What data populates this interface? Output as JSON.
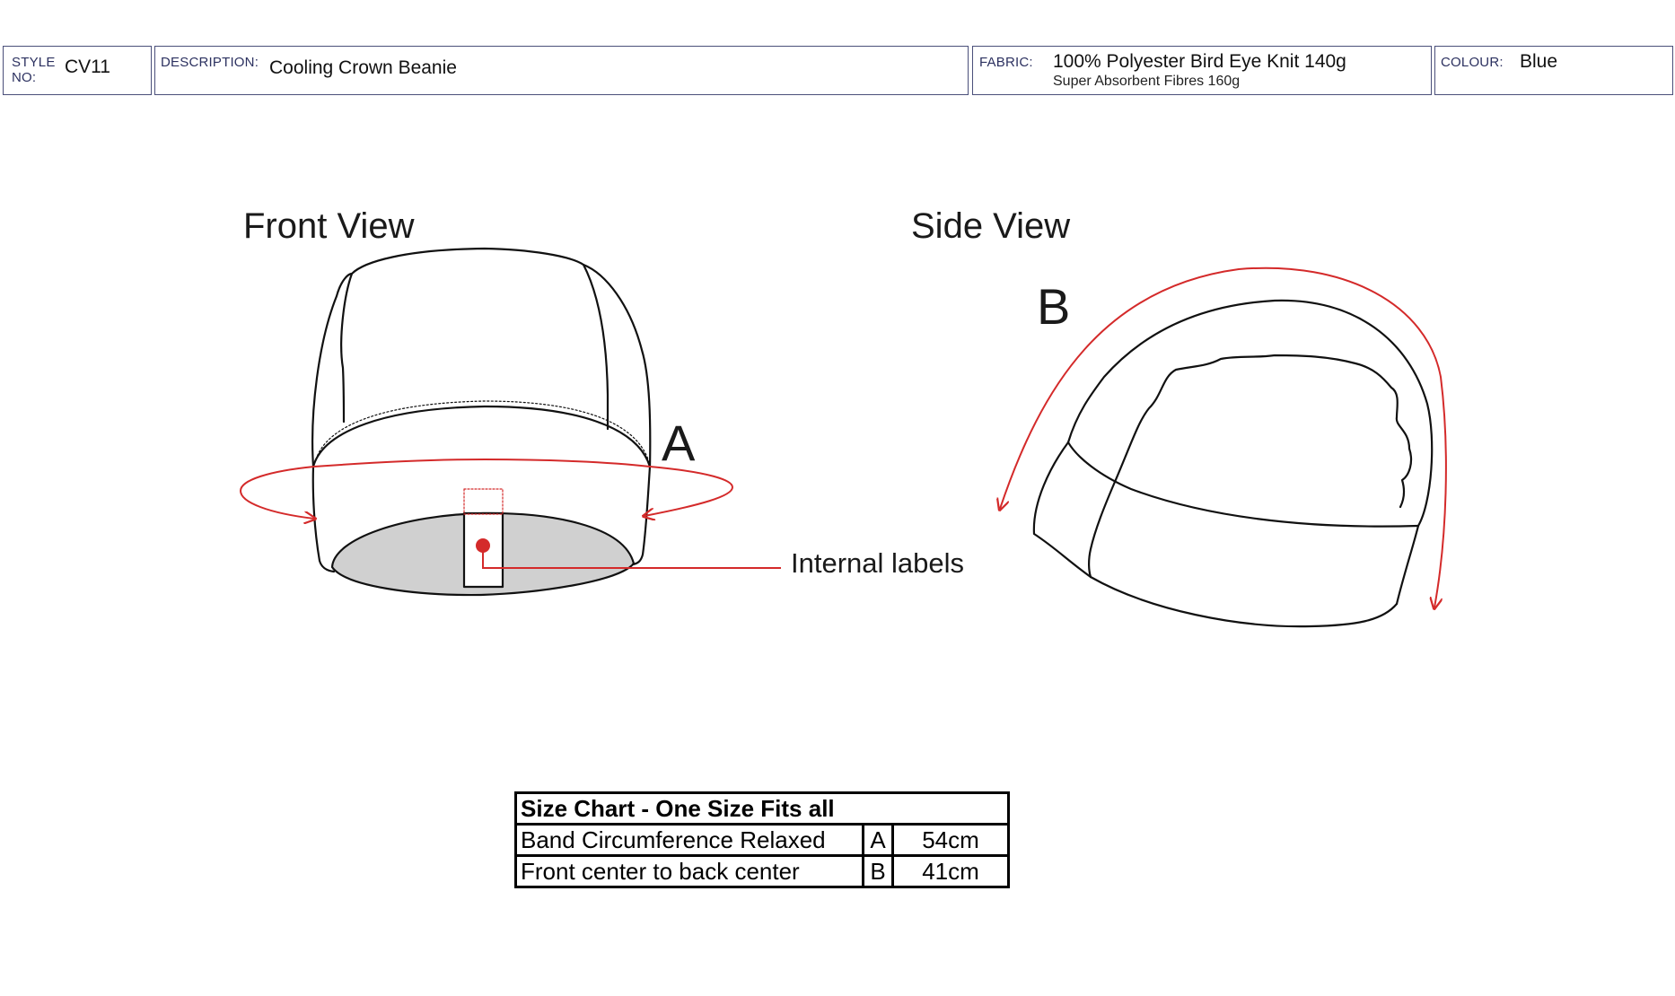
{
  "header": {
    "style": {
      "label": "STYLE NO:",
      "label_line1": "STYLE",
      "label_line2": "NO:",
      "value": "CV11"
    },
    "description": {
      "label": "DESCRIPTION:",
      "value": "Cooling Crown Beanie"
    },
    "fabric": {
      "label": "FABRIC:",
      "value": "100% Polyester Bird Eye Knit 140g",
      "value2": "Super Absorbent Fibres 160g"
    },
    "colour": {
      "label": "COLOUR:",
      "value": "Blue"
    }
  },
  "views": {
    "front": {
      "title": "Front View",
      "measure_letter": "A",
      "callout": "Internal labels"
    },
    "side": {
      "title": "Side View",
      "measure_letter": "B"
    }
  },
  "size_chart": {
    "title": "Size Chart - One Size Fits all",
    "rows": [
      {
        "name": "Band Circumference Relaxed",
        "key": "A",
        "value": "54cm"
      },
      {
        "name": "Front center to back center",
        "key": "B",
        "value": "41cm"
      }
    ]
  },
  "colors": {
    "measure_line": "#d42a2a",
    "header_border": "#4a4f7a",
    "inner_fill": "#d0d0d0"
  }
}
